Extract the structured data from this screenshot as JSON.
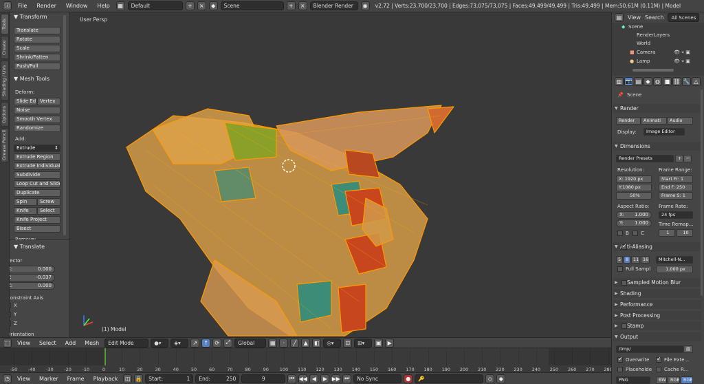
{
  "topbar": {
    "menus": [
      "File",
      "Render",
      "Window",
      "Help"
    ],
    "layout": "Default",
    "scene": "Scene",
    "engine": "Blender Render",
    "stats": "v2.72 | Verts:23,700/23,700 | Edges:73,075/73,075 | Faces:49,499/49,499 | Tris:49,499 | Mem:50.61M (0.11M) | Model"
  },
  "tabs": [
    "Tools",
    "Create",
    "Shading / UVs",
    "Options",
    "Grease Pencil"
  ],
  "transform": {
    "title": "Transform",
    "buttons": [
      "Translate",
      "Rotate",
      "Scale",
      "Shrink/Fatten",
      "Push/Pull"
    ]
  },
  "meshtools": {
    "title": "Mesh Tools",
    "deform": "Deform:",
    "slide_edge": "Slide Ed",
    "vertex": "Vertex",
    "noise": "Noise",
    "smooth": "Smooth Vertex",
    "randomize": "Randomize",
    "add": "Add:",
    "extrude": "Extrude",
    "extrude_region": "Extrude Region",
    "extrude_individual": "Extrude Individual",
    "subdivide": "Subdivide",
    "loop_cut": "Loop Cut and Slide",
    "duplicate": "Duplicate",
    "spin": "Spin",
    "screw": "Screw",
    "knife": "Knife",
    "select": "Select",
    "knife_project": "Knife Project",
    "bisect": "Bisect",
    "remove": "Remove:"
  },
  "operator": {
    "title": "Translate",
    "vector": "Vector",
    "x_label": "X:",
    "x_val": "0.000",
    "y_label": "Y:",
    "y_val": "-0.037",
    "z_label": "Z:",
    "z_val": "0.000",
    "constraint": "Constraint Axis",
    "cx": "X",
    "cy": "Y",
    "cz": "Z",
    "orientation": "Orientation"
  },
  "viewport": {
    "view_name": "User Persp",
    "object_name": "(1) Model"
  },
  "outliner": {
    "view": "View",
    "search": "Search",
    "all_scenes": "All Scenes",
    "items": [
      "Scene",
      "RenderLayers",
      "World",
      "Camera",
      "Lamp"
    ]
  },
  "props": {
    "scene": "Scene",
    "render": {
      "title": "Render",
      "render_btn": "Render",
      "anim_btn": "Animati",
      "audio_btn": "Audio",
      "display_label": "Display:",
      "display_val": "Image Editor"
    },
    "dimensions": {
      "title": "Dimensions",
      "presets": "Render Presets",
      "resolution": "Resolution:",
      "res_x": "X: 1920 px",
      "res_y": "Y:1080 px",
      "res_pct": "50%",
      "frame_range": "Frame Range:",
      "start": "Start Fr: 1",
      "end": "End F: 250",
      "step": "Frame S: 1",
      "aspect": "Aspect Ratio:",
      "asp_x": "X:",
      "asp_x_val": "1.000",
      "asp_y": "Y:",
      "asp_y_val": "1.000",
      "frame_rate": "Frame Rate:",
      "fps": "24 fps",
      "time_remap": "Time Remap...",
      "b": "B",
      "c": "C",
      "remap_old": "1",
      "remap_new": "10"
    },
    "aa": {
      "title": "Anti-Aliasing",
      "s5": "5",
      "s8": "8",
      "s11": "11",
      "s16": "16",
      "filter": "Mitchell-N...",
      "full": "Full Sampl",
      "size": "1.000 px"
    },
    "motion_blur": "Sampled Motion Blur",
    "shading": "Shading",
    "performance": "Performance",
    "post_processing": "Post Processing",
    "stamp": "Stamp",
    "output": {
      "title": "Output",
      "path": "/tmp/",
      "overwrite": "Overwrite",
      "file_ext": "File Exte...",
      "placeholders": "Placeholde",
      "cache": "Cache R...",
      "format": "PNG",
      "bw": "BW",
      "rgb": "RGB",
      "rgba": "RGB"
    }
  },
  "vheader": {
    "view": "View",
    "select": "Select",
    "add": "Add",
    "mesh": "Mesh",
    "mode": "Edit Mode",
    "orient": "Global"
  },
  "timeline": {
    "ticks": [
      "-50",
      "-40",
      "-30",
      "-20",
      "-10",
      "0",
      "10",
      "20",
      "30",
      "40",
      "50",
      "60",
      "70",
      "80",
      "90",
      "100",
      "110",
      "120",
      "130",
      "140",
      "150",
      "160",
      "170",
      "180",
      "190",
      "200",
      "210",
      "220",
      "230",
      "240",
      "250",
      "260",
      "270",
      "280"
    ]
  },
  "tlheader": {
    "view": "View",
    "marker": "Marker",
    "frame": "Frame",
    "playback": "Playback",
    "start": "Start:",
    "start_val": "1",
    "end": "End:",
    "end_val": "250",
    "current": "9",
    "sync": "No Sync"
  },
  "colors": {
    "mesh": "#e8a030",
    "wire": "#ff9a00",
    "red": "#c8461e",
    "teal": "#3c8c78",
    "green": "#8aa028",
    "accent": "#5680c2"
  }
}
